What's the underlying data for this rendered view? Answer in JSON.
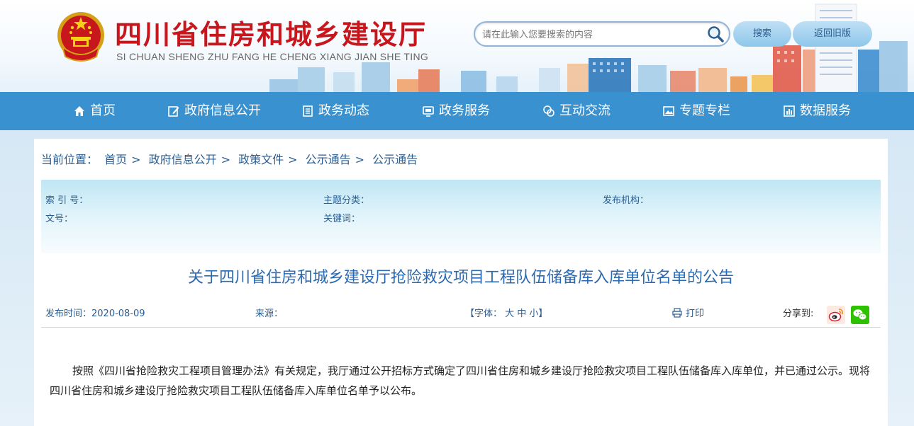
{
  "header": {
    "title": "四川省住房和城乡建设厅",
    "pinyin": "SI CHUAN SHENG ZHU FANG HE CHENG XIANG JIAN SHE TING",
    "search_placeholder": "请在此输入您要搜索的内容",
    "search_label": "搜索",
    "old_version_label": "返回旧版"
  },
  "nav": {
    "items": [
      {
        "label": "首页",
        "icon": "home-icon"
      },
      {
        "label": "政府信息公开",
        "icon": "edit-icon"
      },
      {
        "label": "政务动态",
        "icon": "document-icon"
      },
      {
        "label": "政务服务",
        "icon": "monitor-icon"
      },
      {
        "label": "互动交流",
        "icon": "chat-icon"
      },
      {
        "label": "专题专栏",
        "icon": "image-icon"
      },
      {
        "label": "数据服务",
        "icon": "chart-icon"
      }
    ]
  },
  "breadcrumb": {
    "prefix": "当前位置：",
    "items": [
      "首页",
      "政府信息公开",
      "政策文件",
      "公示通告",
      "公示通告"
    ],
    "separator": ">"
  },
  "meta": {
    "index_label": "索 引 号：",
    "topic_label": "主题分类：",
    "publisher_label": "发布机构：",
    "docno_label": "文号：",
    "keywords_label": "关键词："
  },
  "article": {
    "title": "关于四川省住房和城乡建设厅抢险救灾项目工程队伍储备库入库单位名单的公告",
    "publish_date": "发布时间：2020-08-09",
    "source": "来源：",
    "font_size": "【字体： 大 中 小】",
    "print": "打印",
    "share": "分享到:",
    "body": "按照《四川省抢险救灾工程项目管理办法》有关规定，我厅通过公开招标方式确定了四川省住房和城乡建设厅抢险救灾项目工程队伍储备库入库单位，并已通过公示。现将四川省住房和城乡建设厅抢险救灾项目工程队伍储备库入库单位名单予以公布。"
  },
  "colors": {
    "title_red": "#c8161d",
    "nav_blue": "#3a91cf",
    "link_blue": "#2b5d91"
  }
}
